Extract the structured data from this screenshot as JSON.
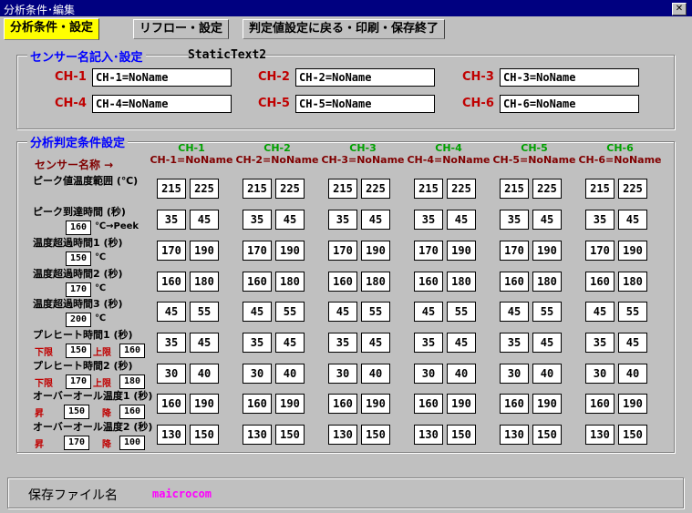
{
  "window": {
    "title": "分析条件･編集"
  },
  "tabs": [
    "分析条件・設定",
    "リフロー・設定",
    "判定値設定に戻る・印刷・保存終了"
  ],
  "sensor_group": {
    "title": "センサー名記入･設定",
    "static_text": "StaticText2",
    "channels": [
      {
        "label": "CH-1",
        "value": "CH-1=NoName"
      },
      {
        "label": "CH-2",
        "value": "CH-2=NoName"
      },
      {
        "label": "CH-3",
        "value": "CH-3=NoName"
      },
      {
        "label": "CH-4",
        "value": "CH-4=NoName"
      },
      {
        "label": "CH-5",
        "value": "CH-5=NoName"
      },
      {
        "label": "CH-6",
        "value": "CH-6=NoName"
      }
    ]
  },
  "judge_group": {
    "title": "分析判定条件設定",
    "sensor_name_label": "センサー名称 →",
    "columns": [
      {
        "ch": "CH-1",
        "name": "CH-1=NoName"
      },
      {
        "ch": "CH-2",
        "name": "CH-2=NoName"
      },
      {
        "ch": "CH-3",
        "name": "CH-3=NoName"
      },
      {
        "ch": "CH-4",
        "name": "CH-4=NoName"
      },
      {
        "ch": "CH-5",
        "name": "CH-5=NoName"
      },
      {
        "ch": "CH-6",
        "name": "CH-6=NoName"
      }
    ],
    "rows": [
      {
        "label": "ピーク値温度範囲 (℃)",
        "values": [
          [
            "215",
            "225"
          ],
          [
            "215",
            "225"
          ],
          [
            "215",
            "225"
          ],
          [
            "215",
            "225"
          ],
          [
            "215",
            "225"
          ],
          [
            "215",
            "225"
          ]
        ]
      },
      {
        "label": "ピーク到達時間   (秒)",
        "sub": {
          "v1": "160",
          "text": "℃→Peek"
        },
        "values": [
          [
            "35",
            "45"
          ],
          [
            "35",
            "45"
          ],
          [
            "35",
            "45"
          ],
          [
            "35",
            "45"
          ],
          [
            "35",
            "45"
          ],
          [
            "35",
            "45"
          ]
        ]
      },
      {
        "label": "温度超過時間1   (秒)",
        "sub": {
          "v1": "150",
          "text": "℃"
        },
        "values": [
          [
            "170",
            "190"
          ],
          [
            "170",
            "190"
          ],
          [
            "170",
            "190"
          ],
          [
            "170",
            "190"
          ],
          [
            "170",
            "190"
          ],
          [
            "170",
            "190"
          ]
        ]
      },
      {
        "label": "温度超過時間2   (秒)",
        "sub": {
          "v1": "170",
          "text": "℃"
        },
        "values": [
          [
            "160",
            "180"
          ],
          [
            "160",
            "180"
          ],
          [
            "160",
            "180"
          ],
          [
            "160",
            "180"
          ],
          [
            "160",
            "180"
          ],
          [
            "160",
            "180"
          ]
        ]
      },
      {
        "label": "温度超過時間3   (秒)",
        "sub": {
          "v1": "200",
          "text": "℃"
        },
        "values": [
          [
            "45",
            "55"
          ],
          [
            "45",
            "55"
          ],
          [
            "45",
            "55"
          ],
          [
            "45",
            "55"
          ],
          [
            "45",
            "55"
          ],
          [
            "45",
            "55"
          ]
        ]
      },
      {
        "label": "プレヒート時間1   (秒)",
        "sub": {
          "l1": "下限",
          "v1": "150",
          "l2": "上限",
          "v2": "160"
        },
        "values": [
          [
            "35",
            "45"
          ],
          [
            "35",
            "45"
          ],
          [
            "35",
            "45"
          ],
          [
            "35",
            "45"
          ],
          [
            "35",
            "45"
          ],
          [
            "35",
            "45"
          ]
        ]
      },
      {
        "label": "プレヒート時間2   (秒)",
        "sub": {
          "l1": "下限",
          "v1": "170",
          "l2": "上限",
          "v2": "180"
        },
        "values": [
          [
            "30",
            "40"
          ],
          [
            "30",
            "40"
          ],
          [
            "30",
            "40"
          ],
          [
            "30",
            "40"
          ],
          [
            "30",
            "40"
          ],
          [
            "30",
            "40"
          ]
        ]
      },
      {
        "label": "オーバーオール温度1 (秒)",
        "sub": {
          "l1": "昇",
          "v1": "150",
          "l2": "降",
          "v2": "160"
        },
        "values": [
          [
            "160",
            "190"
          ],
          [
            "160",
            "190"
          ],
          [
            "160",
            "190"
          ],
          [
            "160",
            "190"
          ],
          [
            "160",
            "190"
          ],
          [
            "160",
            "190"
          ]
        ]
      },
      {
        "label": "オーバーオール温度2 (秒)",
        "sub": {
          "l1": "昇",
          "v1": "170",
          "l2": "降",
          "v2": "100"
        },
        "values": [
          [
            "130",
            "150"
          ],
          [
            "130",
            "150"
          ],
          [
            "130",
            "150"
          ],
          [
            "130",
            "150"
          ],
          [
            "130",
            "150"
          ],
          [
            "130",
            "150"
          ]
        ]
      }
    ]
  },
  "footer": {
    "label": "保存ファイル名",
    "filename": "maicrocom"
  },
  "colors": {
    "title_bar": "#000080",
    "active_tab": "#ffff00",
    "group_title": "#0000ff",
    "ch_label": "#c00000",
    "ch_header": "#00a000",
    "filename": "#ff00ff"
  }
}
